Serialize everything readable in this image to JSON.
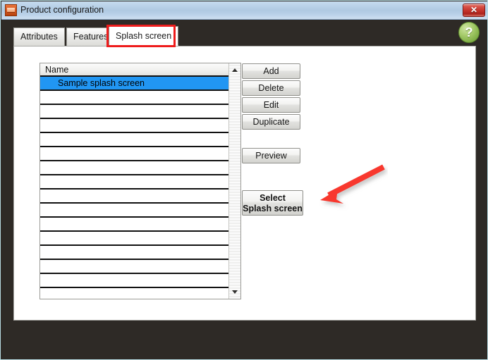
{
  "window": {
    "title": "Product configuration",
    "icon": "application-icon",
    "close_label": "✕",
    "frame_color": "#2e2a26",
    "titlebar_color": "#b9d1e8",
    "close_button_color": "#c3322a"
  },
  "help": {
    "label": "?",
    "color": "#87b44c"
  },
  "tabs": [
    {
      "label": "Attributes",
      "active": false
    },
    {
      "label": "Features",
      "active": false
    },
    {
      "label": "Splash screen",
      "active": true
    }
  ],
  "annotations": {
    "tab_highlight_color": "#ee1c1c",
    "arrow_color": "#f8392e",
    "arrow_target": "Select Splash screen"
  },
  "list": {
    "header": "Name",
    "selected_index": 0,
    "selection_color": "#2196f3",
    "rows": [
      "Sample splash screen",
      "",
      "",
      "",
      "",
      "",
      "",
      "",
      "",
      "",
      "",
      "",
      "",
      "",
      ""
    ]
  },
  "scrollbar": {
    "up_arrow": "scroll-up",
    "down_arrow": "scroll-down"
  },
  "buttons": {
    "add": "Add",
    "delete": "Delete",
    "edit": "Edit",
    "duplicate": "Duplicate",
    "preview": "Preview",
    "select_line1": "Select",
    "select_line2": "Splash screen"
  }
}
